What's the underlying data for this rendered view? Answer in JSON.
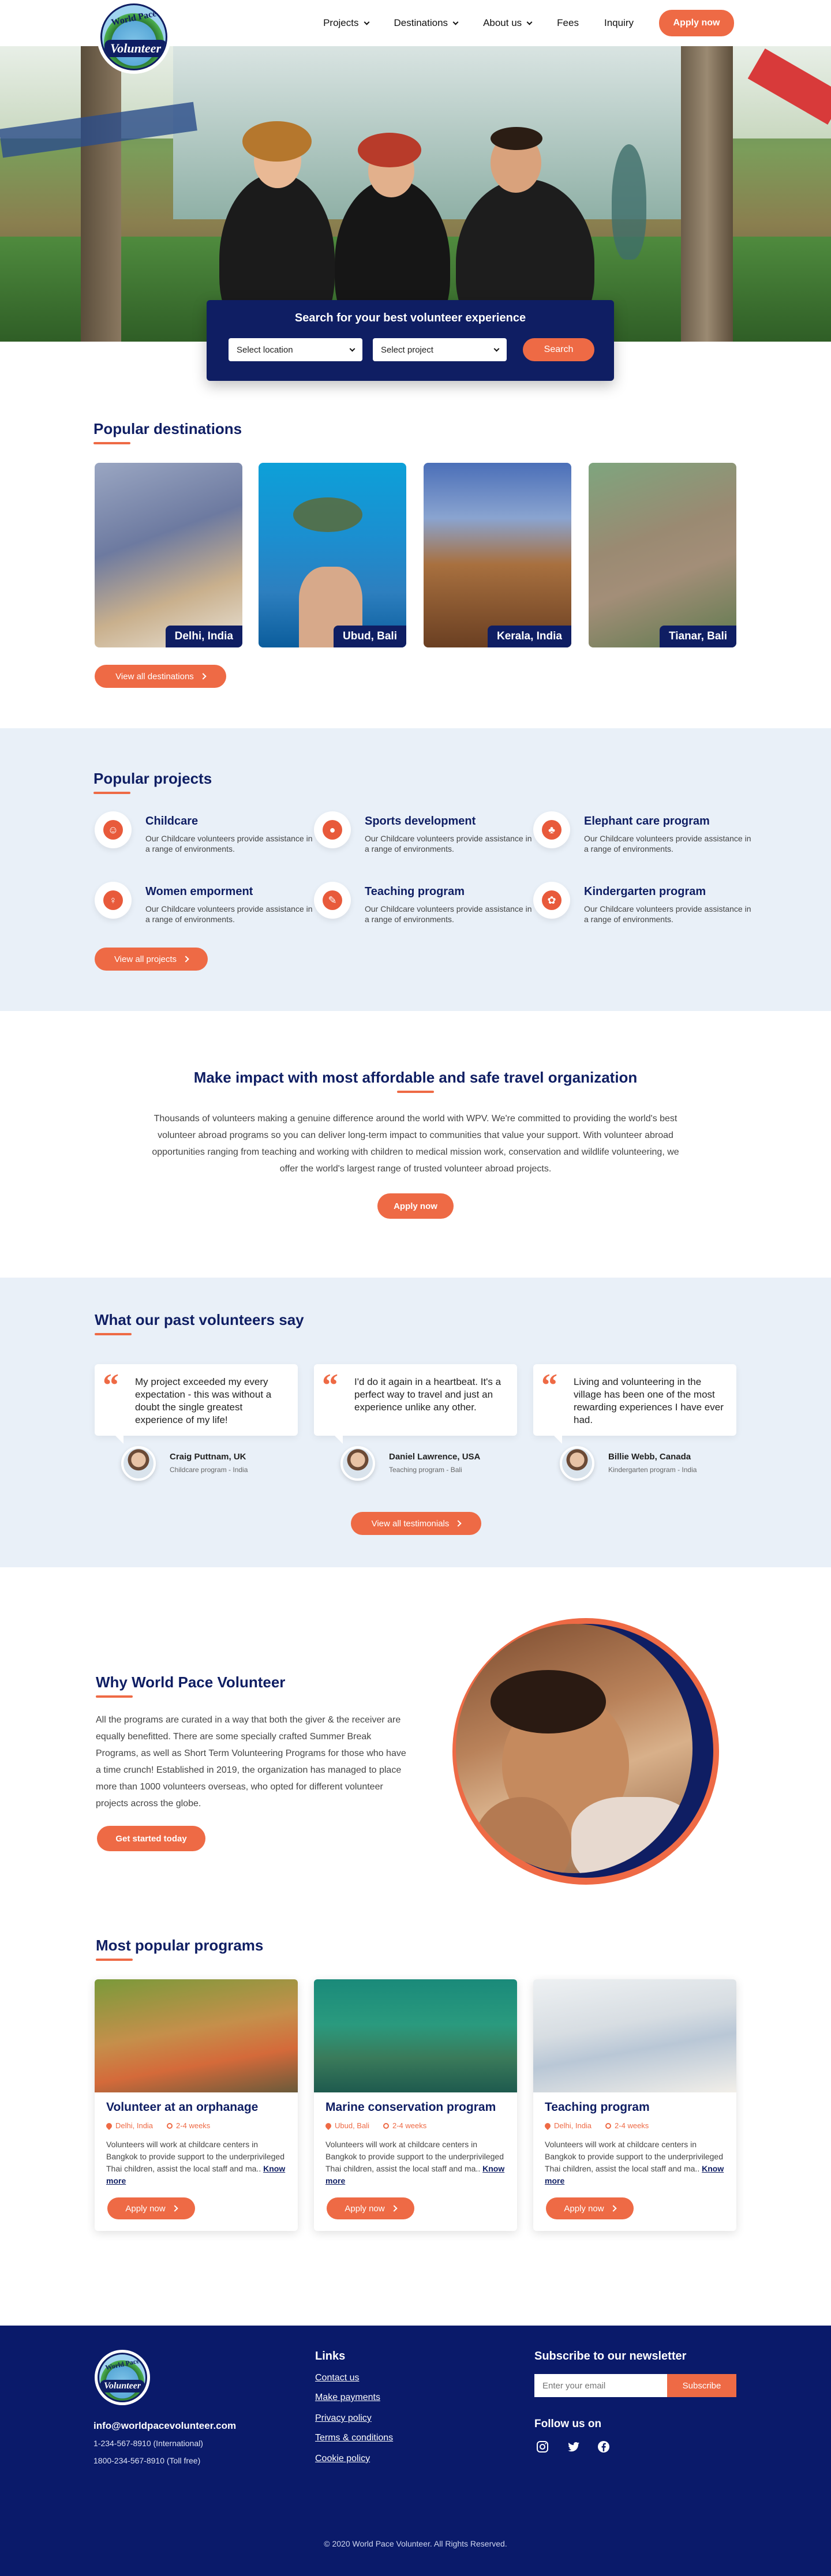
{
  "header": {
    "logo_text_1": "World Pace",
    "logo_text_2": "Volunteer",
    "nav": [
      {
        "label": "Projects"
      },
      {
        "label": "Destinations"
      },
      {
        "label": "About us"
      },
      {
        "label": "Fees"
      },
      {
        "label": "Inquiry"
      }
    ],
    "apply_label": "Apply now"
  },
  "search": {
    "title": "Search for your best volunteer experience",
    "location": "Select location",
    "project": "Select project",
    "button": "Search"
  },
  "destinations": {
    "title": "Popular destinations",
    "items": [
      {
        "label": "Delhi, India"
      },
      {
        "label": "Ubud, Bali"
      },
      {
        "label": "Kerala, India"
      },
      {
        "label": "Tianar, Bali"
      }
    ],
    "view_all": "View all destinations"
  },
  "projects": {
    "title": "Popular projects",
    "items": [
      {
        "title": "Childcare",
        "desc": "Our Childcare volunteers provide assistance in a range of environments."
      },
      {
        "title": "Sports development",
        "desc": "Our Childcare volunteers provide assistance in a range of environments."
      },
      {
        "title": "Elephant care program",
        "desc": "Our Childcare volunteers provide assistance in a range of environments."
      },
      {
        "title": "Women emporment",
        "desc": "Our Childcare volunteers provide assistance in a range of environments."
      },
      {
        "title": "Teaching program",
        "desc": "Our Childcare volunteers provide assistance in a range of environments."
      },
      {
        "title": "Kindergarten program",
        "desc": "Our Childcare volunteers provide assistance in a range of environments."
      }
    ],
    "view_all": "View all projects"
  },
  "impact": {
    "title": "Make impact with most affordable and safe travel organization",
    "text": "Thousands of volunteers making a genuine difference around the world with WPV. We're committed to providing the world's best volunteer abroad programs so you can deliver long-term impact to communities that value your support. With volunteer abroad opportunities ranging from teaching and working with children to medical mission work, conservation and wildlife volunteering, we offer the world's largest range of trusted volunteer abroad projects.",
    "button": "Apply now"
  },
  "testimonials": {
    "title": "What our past volunteers say",
    "items": [
      {
        "quote": "My project exceeded my every expectation - this was without a doubt the single greatest experience of my life!",
        "name": "Craig Puttnam, UK",
        "role": "Childcare program - India"
      },
      {
        "quote": "I'd do it again in a heartbeat. It's a perfect way to travel and just an experience unlike any other.",
        "name": "Daniel Lawrence, USA",
        "role": "Teaching program - Bali"
      },
      {
        "quote": "Living and volunteering in the village has been one of the most rewarding experiences I have ever had.",
        "name": "Billie Webb, Canada",
        "role": "Kindergarten program - India"
      }
    ],
    "view_all": "View all testimonials"
  },
  "why": {
    "title": "Why World Pace Volunteer",
    "text": "All the programs are curated in a way that both the giver & the receiver are equally benefitted. There are some specially crafted Summer Break Programs, as well as Short Term Volunteering Programs for those who have a time crunch! Established in 2019, the organization has managed to place more than 1000 volunteers overseas, who opted for different volunteer projects across the globe.",
    "button": "Get started today"
  },
  "programs": {
    "title": "Most popular programs",
    "items": [
      {
        "name": "Volunteer at an orphanage",
        "location": "Delhi, India",
        "duration": "2-4 weeks",
        "text": "Volunteers will work at childcare centers in Bangkok to provide support to the underprivileged Thai children, assist the local staff and ma..",
        "more": "Know more",
        "apply": "Apply now"
      },
      {
        "name": "Marine conservation program",
        "location": "Ubud, Bali",
        "duration": "2-4 weeks",
        "text": "Volunteers will work at childcare centers in Bangkok to provide support to the underprivileged Thai children, assist the local staff and ma..",
        "more": "Know more",
        "apply": "Apply now"
      },
      {
        "name": "Teaching program",
        "location": "Delhi, India",
        "duration": "2-4 weeks",
        "text": "Volunteers will work at childcare centers in Bangkok to provide support to the underprivileged Thai children, assist the local staff and ma..",
        "more": "Know more",
        "apply": "Apply now"
      }
    ]
  },
  "footer": {
    "email": "info@worldpacevolunteer.com",
    "phone_intl": "1-234-567-8910 (International)",
    "phone_free": "1800-234-567-8910 (Toll free)",
    "links_title": "Links",
    "links": [
      {
        "label": "Contact us"
      },
      {
        "label": "Make payments"
      },
      {
        "label": "Privacy policy"
      },
      {
        "label": "Terms & conditions"
      },
      {
        "label": "Cookie policy"
      }
    ],
    "newsletter_title": "Subscribe to our newsletter",
    "email_placeholder": "Enter your email",
    "subscribe": "Subscribe",
    "follow": "Follow us on",
    "social": [
      "instagram-icon",
      "twitter-icon",
      "facebook-icon"
    ],
    "copyright": "© 2020 World Pace Volunteer. All Rights Reserved."
  },
  "colors": {
    "navy": "#0f1e63",
    "accent": "#ee6a45",
    "light_bg": "#e9f0f8",
    "footer_bg": "#0a1a6a"
  }
}
